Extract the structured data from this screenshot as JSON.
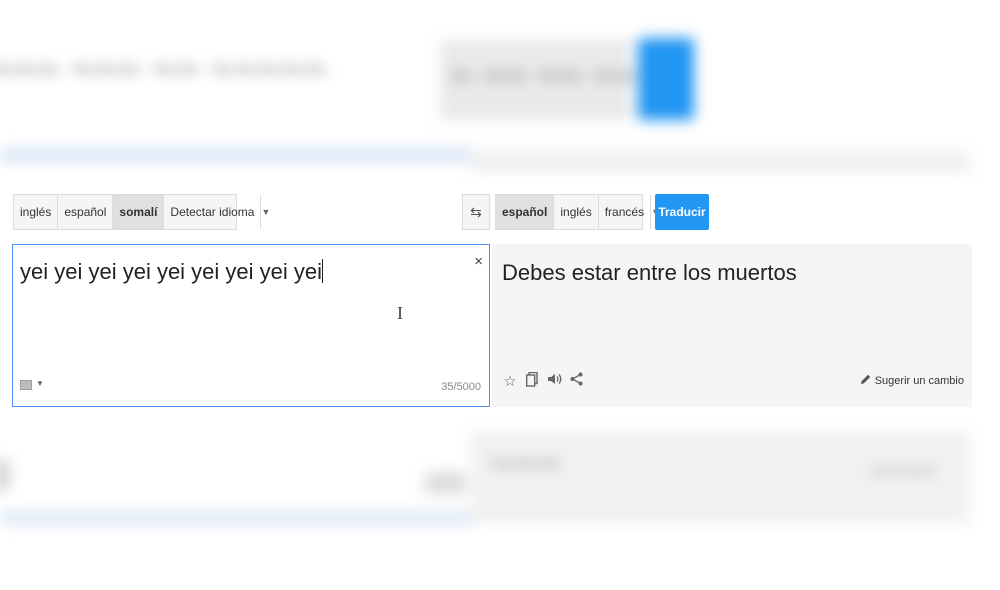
{
  "source_langs": {
    "items": [
      {
        "label": "inglés",
        "active": false
      },
      {
        "label": "español",
        "active": false
      },
      {
        "label": "somalí",
        "active": true
      },
      {
        "label": "Detectar idioma",
        "active": false
      }
    ]
  },
  "target_langs": {
    "items": [
      {
        "label": "español",
        "active": true
      },
      {
        "label": "inglés",
        "active": false
      },
      {
        "label": "francés",
        "active": false
      }
    ]
  },
  "translate_button": "Traducir",
  "source": {
    "text": "yei yei yei yei yei yei yei yei yei",
    "clear": "×",
    "char_count": "35/5000"
  },
  "target": {
    "text": "Debes estar entre los muertos",
    "suggest_label": "Sugerir un cambio"
  },
  "icons": {
    "swap": "swap-icon",
    "star": "star-icon",
    "copy": "copy-icon",
    "speaker": "speaker-icon",
    "share": "share-icon",
    "pencil": "pencil-icon",
    "keyboard": "keyboard-icon"
  },
  "colors": {
    "accent": "#2196f3",
    "focus_border": "#4d90fe"
  }
}
